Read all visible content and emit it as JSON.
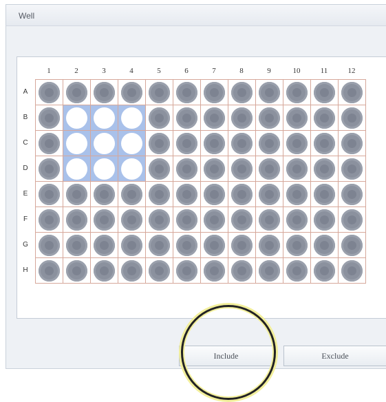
{
  "window": {
    "title": "Well"
  },
  "plate": {
    "columns": [
      "1",
      "2",
      "3",
      "4",
      "5",
      "6",
      "7",
      "8",
      "9",
      "10",
      "11",
      "12"
    ],
    "rows": [
      "A",
      "B",
      "C",
      "D",
      "E",
      "F",
      "G",
      "H"
    ],
    "selected_wells": [
      "B2",
      "B3",
      "B4",
      "C2",
      "C3",
      "C4",
      "D2",
      "D3",
      "D4"
    ]
  },
  "buttons": {
    "include": "Include",
    "exclude": "Exclude"
  },
  "colors": {
    "selection": "#a9c1ea",
    "well": "#8b919e",
    "grid_line": "#d6a79a",
    "highlight": "#f2ef9a"
  }
}
